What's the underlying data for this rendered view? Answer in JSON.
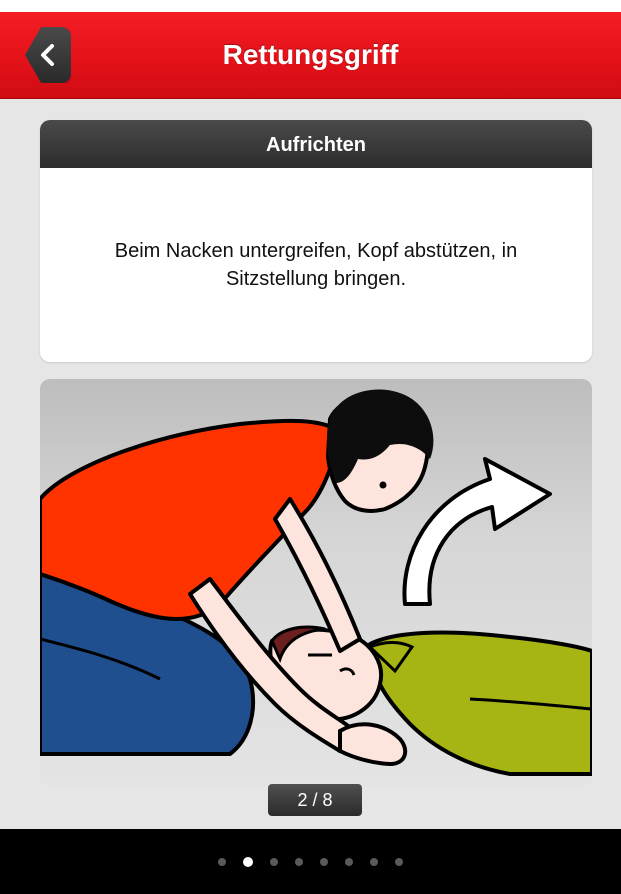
{
  "nav": {
    "title": "Rettungsgriff",
    "back_icon": "chevron-left-icon"
  },
  "card": {
    "heading": "Aufrichten",
    "instruction": "Beim Nacken untergreifen, Kopf abstützen, in Sitzstellung bringen."
  },
  "illustration": {
    "subject": "rescuer-lifting-person-illustration",
    "arrow_icon": "curved-arrow-icon"
  },
  "pager": {
    "label": "2 / 8",
    "current": 2,
    "total": 8
  },
  "colors": {
    "navbar": "#e5121a",
    "rescuer_shirt": "#ff3300",
    "rescuer_pants": "#1f4f8f",
    "patient_shirt": "#a6b514",
    "card_header": "#333333"
  }
}
